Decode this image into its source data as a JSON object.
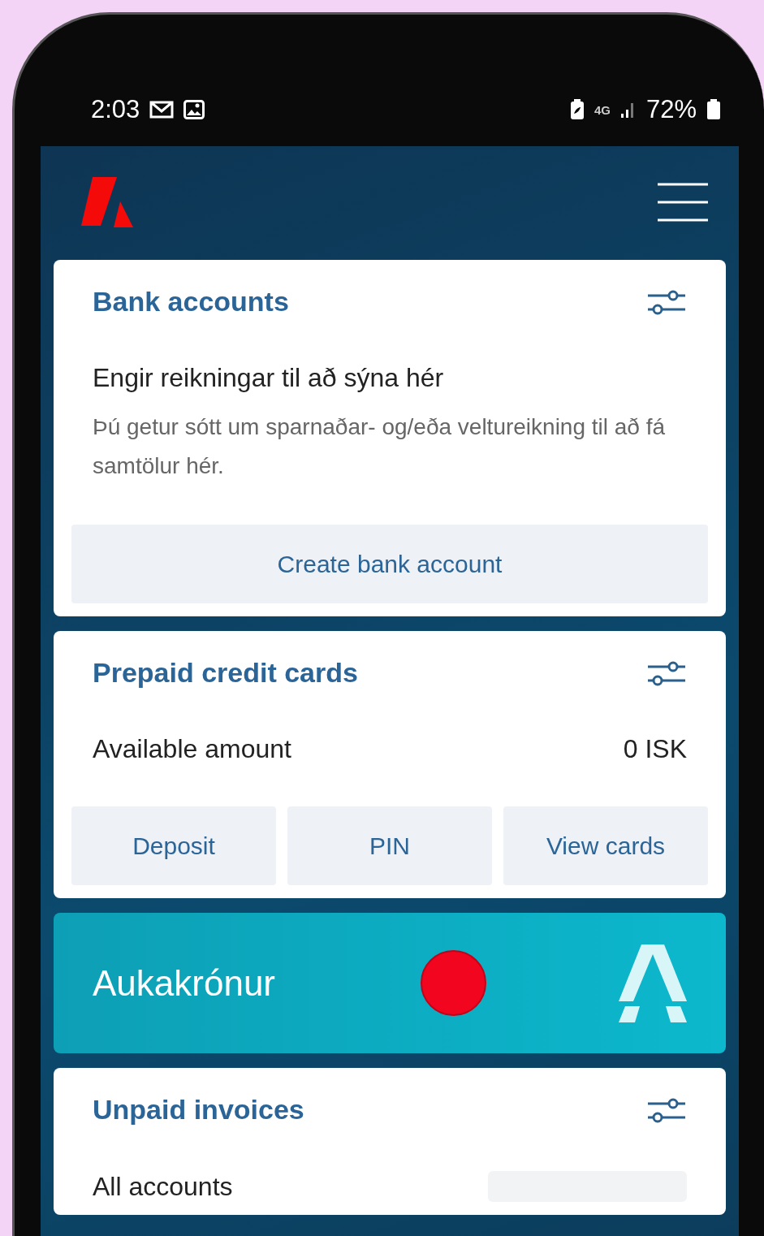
{
  "status_bar": {
    "time": "2:03",
    "network": "4G",
    "battery": "72%"
  },
  "bank_accounts": {
    "title": "Bank accounts",
    "empty_title": "Engir reikningar til að sýna hér",
    "empty_text": "Þú getur sótt um sparnaðar- og/eða veltureikning til að fá samtölur hér.",
    "button": "Create bank account"
  },
  "prepaid_cards": {
    "title": "Prepaid credit cards",
    "label": "Available amount",
    "value": "0 ISK",
    "buttons": [
      "Deposit",
      "PIN",
      "View cards"
    ]
  },
  "banner": {
    "title": "Aukakrónur"
  },
  "unpaid_invoices": {
    "title": "Unpaid invoices",
    "label": "All accounts",
    "loading": true
  }
}
